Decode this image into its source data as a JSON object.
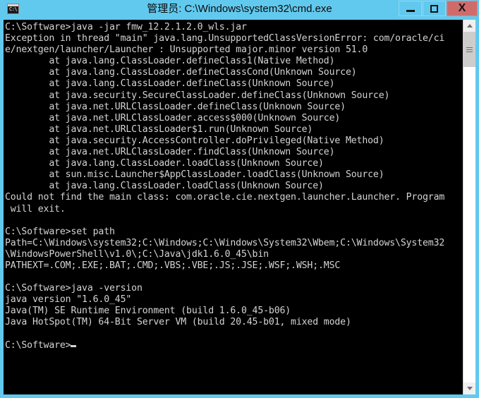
{
  "window": {
    "title": "管理员: C:\\Windows\\system32\\cmd.exe",
    "app_icon_name": "cmd-icon",
    "icon_prompt_text": "C:\\",
    "accent_color": "#62c9ee",
    "close_button_color": "#d06b6b",
    "console_background": "#000000",
    "console_foreground": "#d4d4d4"
  },
  "titlebar": {
    "minimize_label": "Minimize",
    "maximize_label": "Maximize",
    "close_label": "X"
  },
  "scrollbar": {
    "up_arrow_label": "Scroll up",
    "down_arrow_label": "Scroll down",
    "thumb_label": "Scrollbar thumb"
  },
  "console": {
    "cursor": "_",
    "lines": [
      "C:\\Software>java -jar fmw_12.2.1.2.0_wls.jar",
      "Exception in thread \"main\" java.lang.UnsupportedClassVersionError: com/oracle/ci",
      "e/nextgen/launcher/Launcher : Unsupported major.minor version 51.0",
      "        at java.lang.ClassLoader.defineClass1(Native Method)",
      "        at java.lang.ClassLoader.defineClassCond(Unknown Source)",
      "        at java.lang.ClassLoader.defineClass(Unknown Source)",
      "        at java.security.SecureClassLoader.defineClass(Unknown Source)",
      "        at java.net.URLClassLoader.defineClass(Unknown Source)",
      "        at java.net.URLClassLoader.access$000(Unknown Source)",
      "        at java.net.URLClassLoader$1.run(Unknown Source)",
      "        at java.security.AccessController.doPrivileged(Native Method)",
      "        at java.net.URLClassLoader.findClass(Unknown Source)",
      "        at java.lang.ClassLoader.loadClass(Unknown Source)",
      "        at sun.misc.Launcher$AppClassLoader.loadClass(Unknown Source)",
      "        at java.lang.ClassLoader.loadClass(Unknown Source)",
      "Could not find the main class: com.oracle.cie.nextgen.launcher.Launcher. Program",
      " will exit.",
      "",
      "C:\\Software>set path",
      "Path=C:\\Windows\\system32;C:\\Windows;C:\\Windows\\System32\\Wbem;C:\\Windows\\System32",
      "\\WindowsPowerShell\\v1.0\\;C:\\Java\\jdk1.6.0_45\\bin",
      "PATHEXT=.COM;.EXE;.BAT;.CMD;.VBS;.VBE;.JS;.JSE;.WSF;.WSH;.MSC",
      "",
      "C:\\Software>java -version",
      "java version \"1.6.0_45\"",
      "Java(TM) SE Runtime Environment (build 1.6.0_45-b06)",
      "Java HotSpot(TM) 64-Bit Server VM (build 20.45-b01, mixed mode)",
      "",
      "C:\\Software>"
    ]
  }
}
